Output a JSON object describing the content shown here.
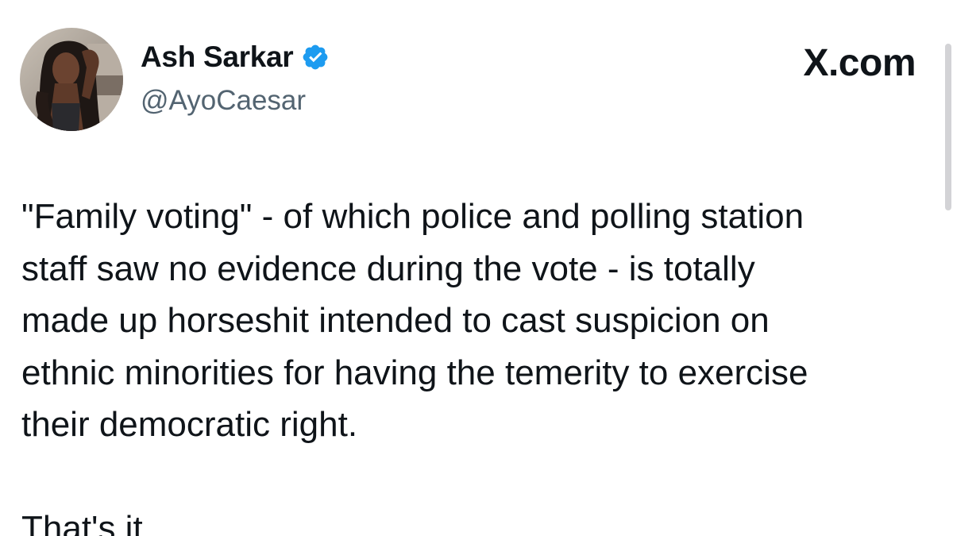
{
  "author": {
    "display_name": "Ash Sarkar",
    "handle": "@AyoCaesar",
    "verified": true,
    "avatar_icon": "profile-photo"
  },
  "brand": {
    "label": "X.com"
  },
  "tweet": {
    "text": "\"Family voting\" - of which police and polling station\nstaff saw no evidence during the vote - is totally\nmade up horseshit intended to cast suspicion on\nethnic minorities for having the temerity to exercise\ntheir democratic right.\n\nThat's it."
  },
  "colors": {
    "text_primary": "#0f1419",
    "text_secondary": "#536471",
    "verified_badge": "#1d9bf0",
    "background": "#ffffff"
  }
}
